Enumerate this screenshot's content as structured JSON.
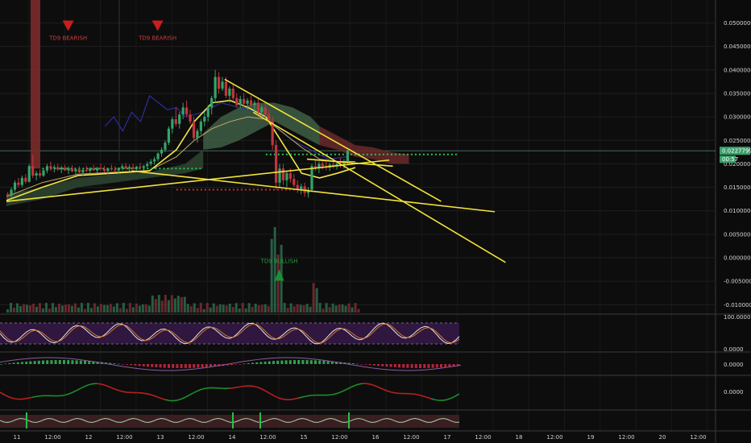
{
  "chart_data": {
    "type": "candlestick",
    "price_axis": {
      "ticks": [
        "0.05000000",
        "0.04500000",
        "0.04000000",
        "0.03500000",
        "0.03000000",
        "0.02500000",
        "0.02000000",
        "0.01500000",
        "0.01000000",
        "0.00500000",
        "0.00000000",
        "-0.00500000",
        "-0.01000000"
      ],
      "ylim": [
        -0.0105,
        0.0528
      ]
    },
    "current_price": "0.02277990",
    "price_tag_small": "00:57",
    "time_axis": [
      "11",
      "12:00",
      "12",
      "12:00",
      "13",
      "12:00",
      "14",
      "12:00",
      "15",
      "12:00",
      "16",
      "12:00",
      "17",
      "12:00",
      "18",
      "12:00",
      "19",
      "12:00",
      "20",
      "12:00"
    ],
    "signals": [
      {
        "text": "TD9 BEARISH",
        "kind": "bearish",
        "t": 3.0,
        "price": 0.0488
      },
      {
        "text": "TD9 BEARISH",
        "kind": "bearish",
        "t": 8.0,
        "price": 0.0488
      },
      {
        "text": "TD9 BULLISH",
        "kind": "bullish",
        "t": 14.8,
        "price": -0.0042
      }
    ],
    "candles": [
      [
        0.0,
        0.0135,
        0.014,
        0.0128,
        0.0132
      ],
      [
        0.2,
        0.0132,
        0.015,
        0.0128,
        0.0145
      ],
      [
        0.4,
        0.0145,
        0.0165,
        0.014,
        0.016
      ],
      [
        0.6,
        0.016,
        0.017,
        0.015,
        0.0155
      ],
      [
        0.8,
        0.0155,
        0.0175,
        0.015,
        0.017
      ],
      [
        1.0,
        0.017,
        0.0178,
        0.0158,
        0.0162
      ],
      [
        1.2,
        0.0162,
        0.02,
        0.016,
        0.0195
      ],
      [
        1.4,
        0.0195,
        0.022,
        0.017,
        0.0175
      ],
      [
        1.6,
        0.0175,
        0.0185,
        0.0165,
        0.018
      ],
      [
        1.8,
        0.018,
        0.0188,
        0.017,
        0.0175
      ],
      [
        2.0,
        0.0175,
        0.019,
        0.0172,
        0.0186
      ],
      [
        2.2,
        0.0186,
        0.02,
        0.018,
        0.0195
      ],
      [
        2.4,
        0.0195,
        0.0205,
        0.0185,
        0.019
      ],
      [
        2.6,
        0.019,
        0.0198,
        0.0182,
        0.0193
      ],
      [
        2.8,
        0.0193,
        0.02,
        0.0185,
        0.0188
      ],
      [
        3.0,
        0.0188,
        0.0196,
        0.018,
        0.0192
      ],
      [
        3.2,
        0.0192,
        0.0198,
        0.0185,
        0.0186
      ],
      [
        3.4,
        0.0186,
        0.0195,
        0.0178,
        0.019
      ],
      [
        3.6,
        0.019,
        0.0197,
        0.0182,
        0.0184
      ],
      [
        3.8,
        0.0184,
        0.0192,
        0.0175,
        0.0188
      ],
      [
        4.0,
        0.0188,
        0.0195,
        0.018,
        0.0182
      ],
      [
        4.2,
        0.0182,
        0.019,
        0.0175,
        0.0187
      ],
      [
        4.4,
        0.0187,
        0.0196,
        0.0182,
        0.0185
      ],
      [
        4.6,
        0.0185,
        0.0193,
        0.0178,
        0.019
      ],
      [
        4.8,
        0.019,
        0.0198,
        0.0185,
        0.0186
      ],
      [
        5.0,
        0.0186,
        0.0194,
        0.018,
        0.0191
      ],
      [
        5.2,
        0.0191,
        0.02,
        0.0186,
        0.0189
      ],
      [
        5.4,
        0.0189,
        0.0196,
        0.0182,
        0.0185
      ],
      [
        5.6,
        0.0185,
        0.0192,
        0.0178,
        0.019
      ],
      [
        5.8,
        0.019,
        0.0198,
        0.0185,
        0.0188
      ],
      [
        6.0,
        0.0188,
        0.0195,
        0.0182,
        0.0186
      ],
      [
        6.2,
        0.0186,
        0.0193,
        0.018,
        0.0191
      ],
      [
        6.4,
        0.0191,
        0.02,
        0.0186,
        0.0195
      ],
      [
        6.6,
        0.0195,
        0.0202,
        0.0188,
        0.019
      ],
      [
        6.8,
        0.019,
        0.0198,
        0.0184,
        0.0193
      ],
      [
        7.0,
        0.0193,
        0.02,
        0.0188,
        0.0189
      ],
      [
        7.2,
        0.0189,
        0.0196,
        0.0182,
        0.0194
      ],
      [
        7.4,
        0.0194,
        0.0202,
        0.019,
        0.0192
      ],
      [
        7.6,
        0.0192,
        0.0198,
        0.0186,
        0.0195
      ],
      [
        7.8,
        0.0195,
        0.0205,
        0.019,
        0.02
      ],
      [
        8.0,
        0.02,
        0.021,
        0.0195,
        0.0205
      ],
      [
        8.2,
        0.0205,
        0.0215,
        0.0198,
        0.021
      ],
      [
        8.4,
        0.021,
        0.0225,
        0.0205,
        0.0222
      ],
      [
        8.6,
        0.0222,
        0.0235,
        0.0215,
        0.023
      ],
      [
        8.8,
        0.023,
        0.025,
        0.0225,
        0.0245
      ],
      [
        9.0,
        0.0245,
        0.028,
        0.024,
        0.0275
      ],
      [
        9.2,
        0.0275,
        0.03,
        0.0265,
        0.0295
      ],
      [
        9.4,
        0.0295,
        0.032,
        0.028,
        0.0285
      ],
      [
        9.6,
        0.0285,
        0.031,
        0.0275,
        0.0305
      ],
      [
        9.8,
        0.0305,
        0.033,
        0.0295,
        0.032
      ],
      [
        10.0,
        0.032,
        0.0335,
        0.03,
        0.0305
      ],
      [
        10.2,
        0.0305,
        0.0315,
        0.0285,
        0.029
      ],
      [
        10.4,
        0.029,
        0.03,
        0.025,
        0.0255
      ],
      [
        10.6,
        0.0255,
        0.0275,
        0.0245,
        0.027
      ],
      [
        10.8,
        0.027,
        0.0295,
        0.0262,
        0.029
      ],
      [
        11.0,
        0.029,
        0.031,
        0.028,
        0.03
      ],
      [
        11.2,
        0.03,
        0.0325,
        0.029,
        0.032
      ],
      [
        11.4,
        0.032,
        0.0345,
        0.0305,
        0.034
      ],
      [
        11.6,
        0.034,
        0.04,
        0.033,
        0.0385
      ],
      [
        11.8,
        0.0385,
        0.0395,
        0.035,
        0.036
      ],
      [
        12.0,
        0.036,
        0.0385,
        0.0355,
        0.0375
      ],
      [
        12.2,
        0.0375,
        0.0385,
        0.034,
        0.0345
      ],
      [
        12.4,
        0.0345,
        0.0365,
        0.033,
        0.036
      ],
      [
        12.6,
        0.036,
        0.037,
        0.0335,
        0.034
      ],
      [
        12.8,
        0.034,
        0.035,
        0.032,
        0.0325
      ],
      [
        13.0,
        0.0325,
        0.0345,
        0.0318,
        0.0338
      ],
      [
        13.2,
        0.0338,
        0.035,
        0.0322,
        0.0328
      ],
      [
        13.4,
        0.0328,
        0.034,
        0.0315,
        0.0335
      ],
      [
        13.6,
        0.0335,
        0.0345,
        0.032,
        0.0325
      ],
      [
        13.8,
        0.0325,
        0.0335,
        0.0312,
        0.033
      ],
      [
        14.0,
        0.033,
        0.0338,
        0.0305,
        0.031
      ],
      [
        14.2,
        0.031,
        0.0325,
        0.03,
        0.032
      ],
      [
        14.4,
        0.032,
        0.033,
        0.03,
        0.0305
      ],
      [
        14.6,
        0.0305,
        0.0315,
        0.0285,
        0.029
      ],
      [
        14.8,
        0.029,
        0.03,
        0.023,
        0.024
      ],
      [
        15.0,
        0.024,
        0.025,
        0.0145,
        0.016
      ],
      [
        15.2,
        0.016,
        0.02,
        0.015,
        0.019
      ],
      [
        15.4,
        0.019,
        0.02,
        0.0155,
        0.0165
      ],
      [
        15.6,
        0.0165,
        0.0185,
        0.015,
        0.018
      ],
      [
        15.8,
        0.018,
        0.019,
        0.016,
        0.0168
      ],
      [
        16.0,
        0.0168,
        0.0178,
        0.015,
        0.0155
      ],
      [
        16.2,
        0.0155,
        0.0165,
        0.0138,
        0.0145
      ],
      [
        16.4,
        0.0145,
        0.0158,
        0.0135,
        0.0152
      ],
      [
        16.6,
        0.0152,
        0.016,
        0.013,
        0.0138
      ],
      [
        16.8,
        0.0138,
        0.015,
        0.0128,
        0.0145
      ],
      [
        17.0,
        0.0145,
        0.02,
        0.014,
        0.0195
      ],
      [
        17.2,
        0.0195,
        0.021,
        0.0185,
        0.019
      ],
      [
        17.4,
        0.019,
        0.0205,
        0.018,
        0.02
      ],
      [
        17.6,
        0.02,
        0.0208,
        0.0188,
        0.0195
      ],
      [
        17.8,
        0.0195,
        0.0205,
        0.0186,
        0.0192
      ],
      [
        18.0,
        0.0192,
        0.0202,
        0.0185,
        0.0198
      ],
      [
        18.2,
        0.0198,
        0.021,
        0.019,
        0.0195
      ],
      [
        18.4,
        0.0195,
        0.0205,
        0.0188,
        0.02
      ],
      [
        18.6,
        0.02,
        0.0212,
        0.0192,
        0.0198
      ],
      [
        18.8,
        0.0198,
        0.021,
        0.019,
        0.0205
      ],
      [
        19.0,
        0.0205,
        0.023,
        0.02,
        0.0228
      ]
    ],
    "trendlines": [
      {
        "from": [
          0.0,
          0.012
        ],
        "to": [
          21.4,
          0.0208
        ]
      },
      {
        "from": [
          7.0,
          0.0185
        ],
        "to": [
          27.3,
          0.0098
        ]
      },
      {
        "from": [
          12.2,
          0.038
        ],
        "to": [
          24.3,
          0.012
        ]
      },
      {
        "from": [
          13.8,
          0.031
        ],
        "to": [
          27.9,
          -0.001
        ]
      },
      {
        "from": [
          16.8,
          0.021
        ],
        "to": [
          21.6,
          0.0195
        ]
      }
    ],
    "ma_yellow": [
      [
        0.0,
        0.0122
      ],
      [
        2.0,
        0.015
      ],
      [
        4.0,
        0.0175
      ],
      [
        6.0,
        0.018
      ],
      [
        8.0,
        0.0185
      ],
      [
        9.5,
        0.023
      ],
      [
        10.5,
        0.029
      ],
      [
        11.5,
        0.033
      ],
      [
        12.5,
        0.0335
      ],
      [
        13.5,
        0.032
      ],
      [
        14.5,
        0.03
      ],
      [
        15.5,
        0.024
      ],
      [
        16.5,
        0.018
      ],
      [
        17.5,
        0.017
      ],
      [
        18.5,
        0.018
      ],
      [
        19.5,
        0.0192
      ]
    ],
    "ma_orange": [
      [
        0.0,
        0.013
      ],
      [
        2.0,
        0.016
      ],
      [
        4.0,
        0.0178
      ],
      [
        6.0,
        0.0182
      ],
      [
        8.0,
        0.0186
      ],
      [
        9.5,
        0.0215
      ],
      [
        10.5,
        0.025
      ],
      [
        11.5,
        0.0275
      ],
      [
        12.5,
        0.029
      ],
      [
        13.5,
        0.03
      ],
      [
        14.5,
        0.0295
      ],
      [
        15.5,
        0.0265
      ],
      [
        16.5,
        0.0235
      ],
      [
        17.5,
        0.021
      ],
      [
        18.5,
        0.0205
      ],
      [
        19.5,
        0.0205
      ]
    ],
    "conversion_line": [
      [
        5.5,
        0.028
      ],
      [
        6.0,
        0.03
      ],
      [
        6.5,
        0.027
      ],
      [
        7.0,
        0.031
      ],
      [
        7.5,
        0.029
      ],
      [
        8.0,
        0.0345
      ],
      [
        8.5,
        0.033
      ],
      [
        9.0,
        0.0315
      ],
      [
        9.5,
        0.032
      ],
      [
        10.0,
        0.03
      ],
      [
        11.0,
        0.031
      ],
      [
        12.0,
        0.033
      ],
      [
        13.0,
        0.032
      ],
      [
        14.0,
        0.031
      ],
      [
        15.0,
        0.028
      ],
      [
        16.0,
        0.025
      ],
      [
        17.0,
        0.023
      ],
      [
        18.0,
        0.021
      ],
      [
        19.0,
        0.0215
      ]
    ],
    "cloud_band": [
      [
        11.0,
        0.023,
        0.0265
      ],
      [
        12.0,
        0.0235,
        0.03
      ],
      [
        13.0,
        0.025,
        0.032
      ],
      [
        14.0,
        0.027,
        0.033
      ],
      [
        15.0,
        0.029,
        0.033
      ],
      [
        16.0,
        0.027,
        0.032
      ],
      [
        17.0,
        0.025,
        0.03
      ],
      [
        17.5,
        0.024,
        0.028
      ]
    ],
    "cloud_band_red": [
      [
        17.5,
        0.024,
        0.028
      ],
      [
        18.5,
        0.023,
        0.026
      ],
      [
        19.5,
        0.0215,
        0.024
      ],
      [
        20.5,
        0.021,
        0.0235
      ],
      [
        21.5,
        0.02,
        0.0225
      ],
      [
        22.5,
        0.02,
        0.022
      ]
    ],
    "subpanels": [
      {
        "label": "100.0000"
      },
      {
        "label": "0.0000"
      },
      {
        "label": "0.0000"
      },
      {
        "label": "0.0000"
      }
    ]
  }
}
